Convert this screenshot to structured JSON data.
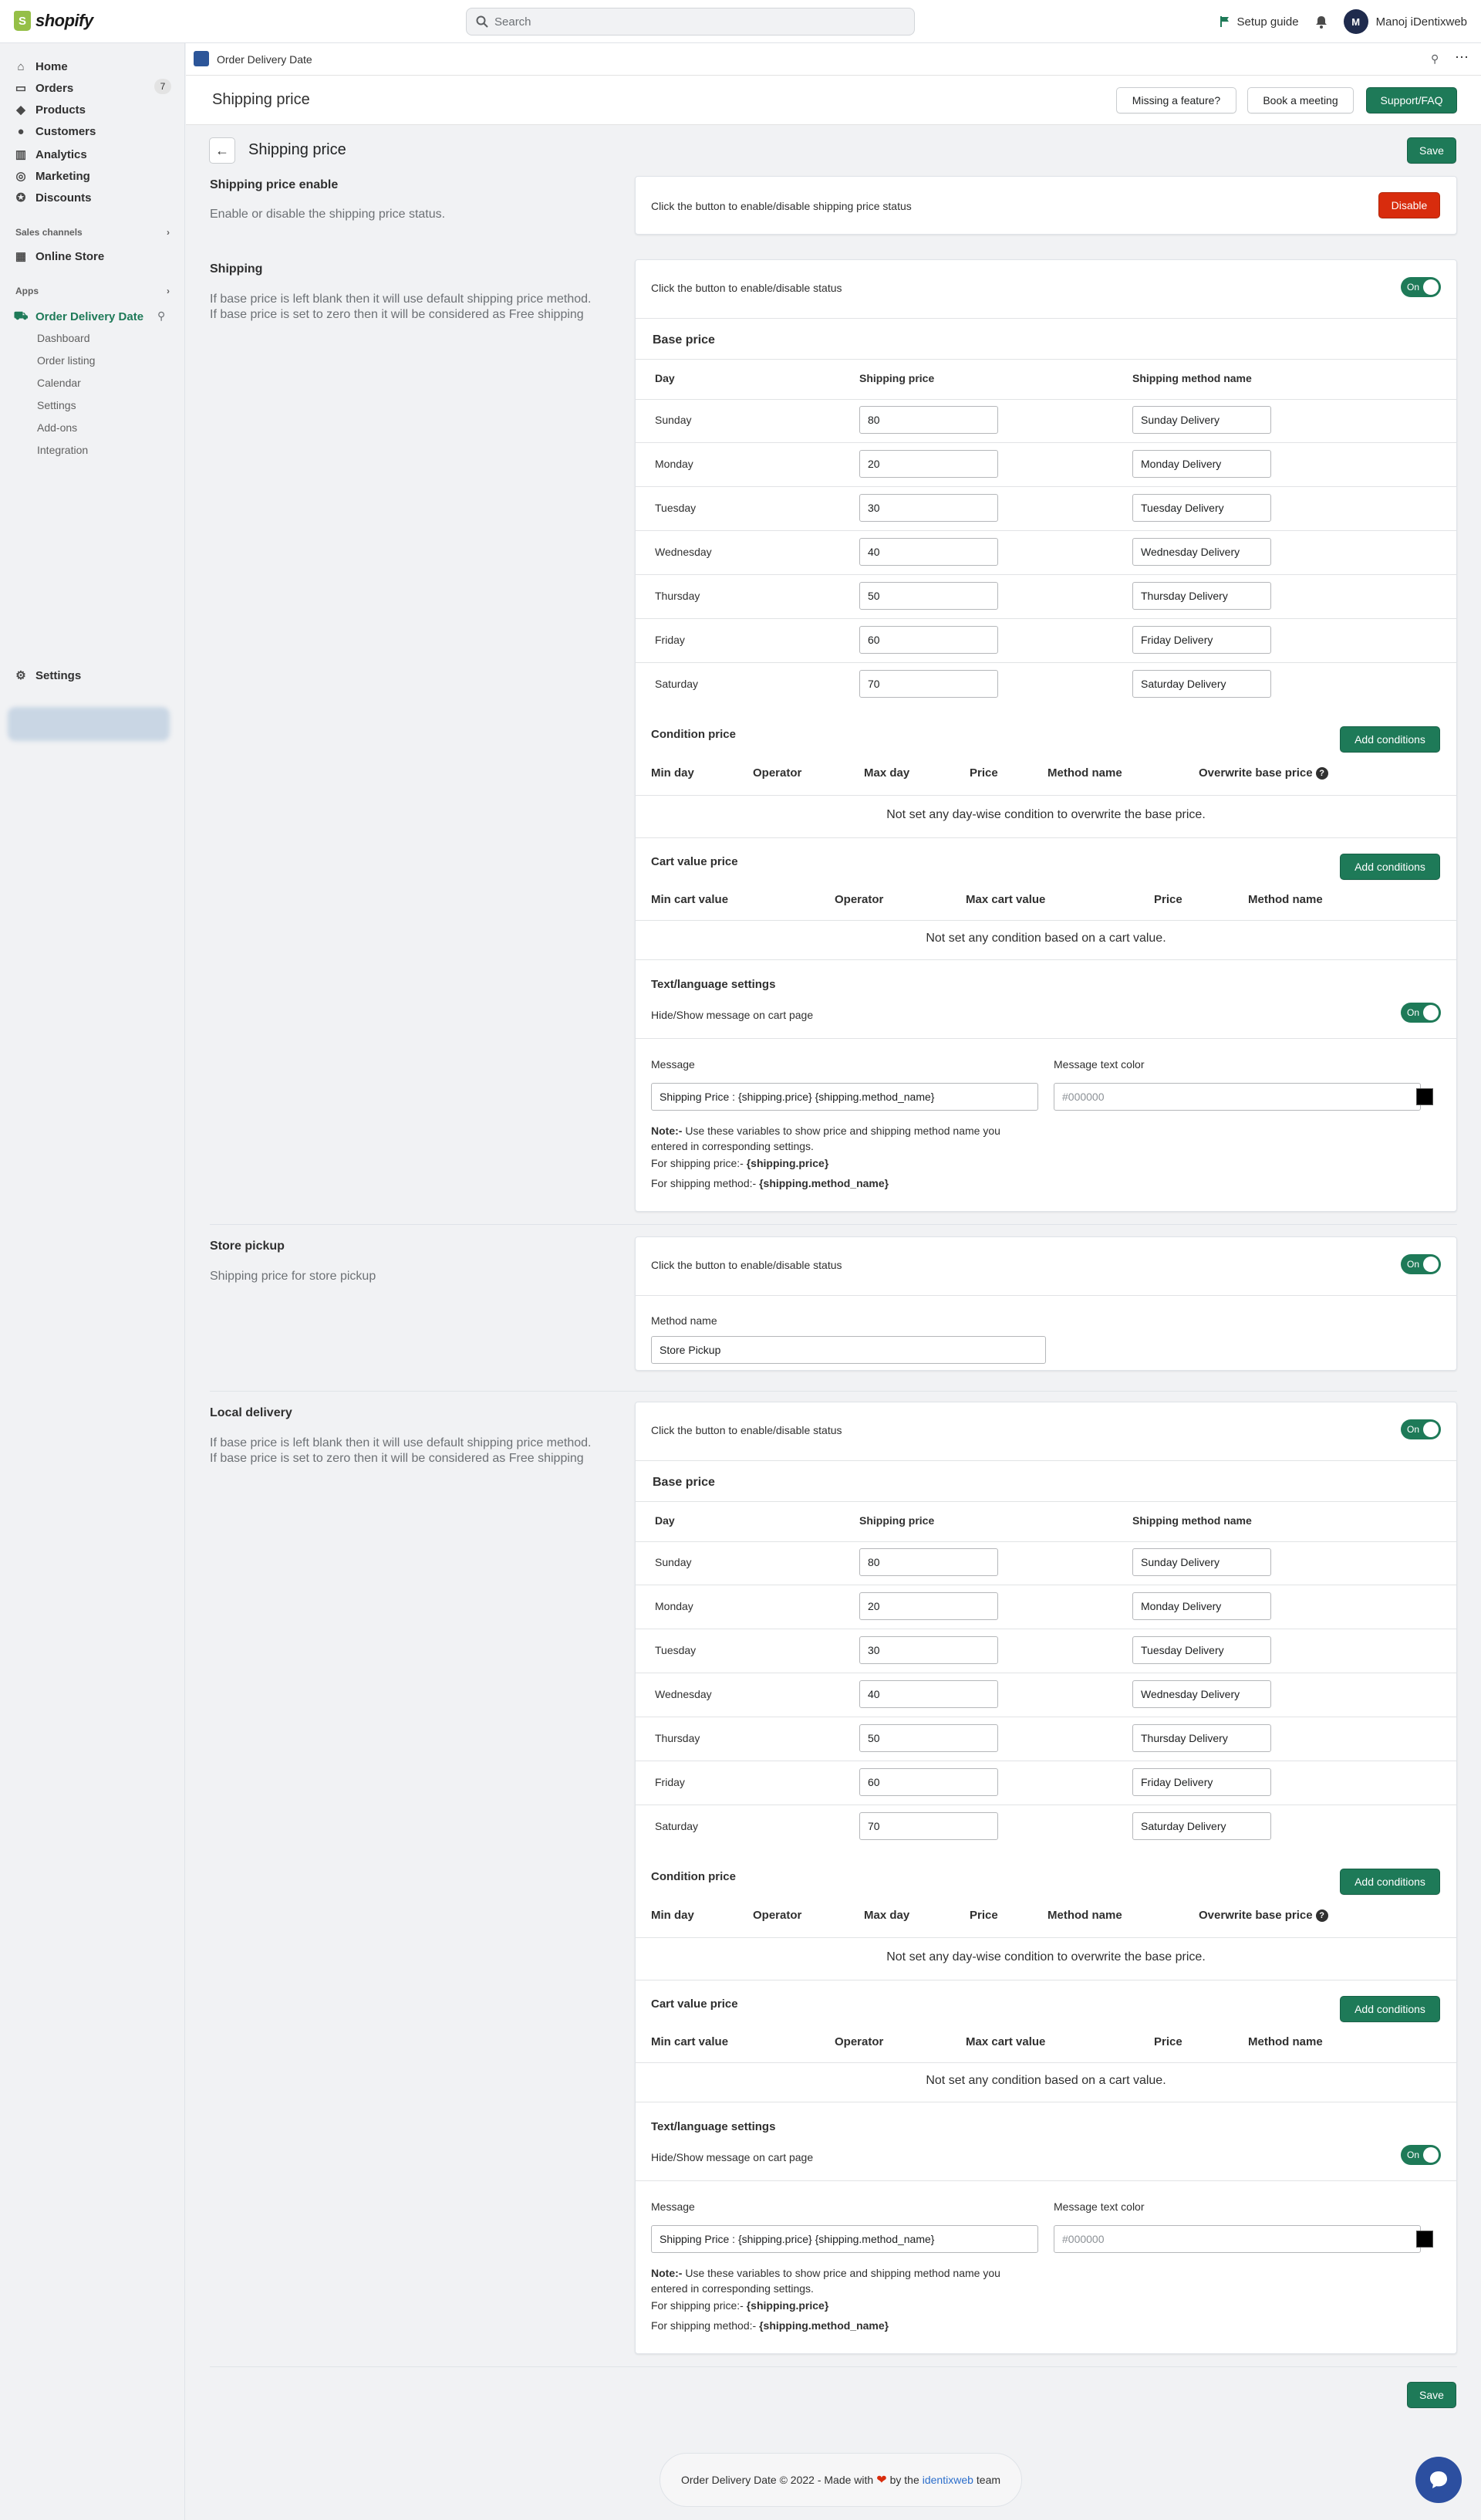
{
  "topbar": {
    "logo": "shopify",
    "search_placeholder": "Search",
    "setup_guide": "Setup guide",
    "avatar_initial": "M",
    "user_name": "Manoj iDentixweb"
  },
  "sidebar": {
    "items": [
      {
        "label": "Home"
      },
      {
        "label": "Orders",
        "badge": "7"
      },
      {
        "label": "Products"
      },
      {
        "label": "Customers"
      },
      {
        "label": "Analytics"
      },
      {
        "label": "Marketing"
      },
      {
        "label": "Discounts"
      }
    ],
    "sales_channels": "Sales channels",
    "online_store": "Online Store",
    "apps": "Apps",
    "app_name": "Order Delivery Date",
    "app_sub": [
      "Dashboard",
      "Order listing",
      "Calendar",
      "Settings",
      "Add-ons",
      "Integration"
    ],
    "settings": "Settings"
  },
  "appbar": {
    "title": "Order Delivery Date"
  },
  "header": {
    "title": "Shipping price",
    "missing": "Missing a feature?",
    "meeting": "Book a meeting",
    "support": "Support/FAQ"
  },
  "page": {
    "title": "Shipping price",
    "save": "Save"
  },
  "enable": {
    "heading": "Shipping price enable",
    "desc": "Enable or disable the shipping price status.",
    "text": "Click the button to enable/disable shipping price status",
    "button": "Disable"
  },
  "status_text": "Click the button to enable/disable status",
  "toggle_on": "On",
  "shipping": {
    "heading": "Shipping",
    "desc1": "If base price is left blank then it will use default shipping price method.",
    "desc2": "If base price is set to zero then it will be considered as Free shipping"
  },
  "base": {
    "title": "Base price",
    "col_day": "Day",
    "col_price": "Shipping price",
    "col_method": "Shipping method name",
    "rows": [
      {
        "day": "Sunday",
        "price": "80",
        "method": "Sunday Delivery"
      },
      {
        "day": "Monday",
        "price": "20",
        "method": "Monday Delivery"
      },
      {
        "day": "Tuesday",
        "price": "30",
        "method": "Tuesday Delivery"
      },
      {
        "day": "Wednesday",
        "price": "40",
        "method": "Wednesday Delivery"
      },
      {
        "day": "Thursday",
        "price": "50",
        "method": "Thursday Delivery"
      },
      {
        "day": "Friday",
        "price": "60",
        "method": "Friday Delivery"
      },
      {
        "day": "Saturday",
        "price": "70",
        "method": "Saturday Delivery"
      }
    ]
  },
  "cond": {
    "title": "Condition price",
    "add": "Add conditions",
    "cols": [
      "Min day",
      "Operator",
      "Max day",
      "Price",
      "Method name",
      "Overwrite base price"
    ],
    "empty": "Not set any day-wise condition to overwrite the base price.",
    "q": "?"
  },
  "cart": {
    "title": "Cart value price",
    "add": "Add conditions",
    "cols": [
      "Min cart value",
      "Operator",
      "Max cart value",
      "Price",
      "Method name"
    ],
    "empty": "Not set any condition based on a cart value."
  },
  "text": {
    "title": "Text/language settings",
    "hide_show": "Hide/Show message on cart page",
    "message_label": "Message",
    "message_value": "Shipping Price : {shipping.price} {shipping.method_name}",
    "color_label": "Message text color",
    "color_placeholder": "#000000",
    "note_prefix": "Note:-",
    "note_text": " Use these variables to show price and shipping method name you",
    "note_text2": "entered in corresponding settings.",
    "price_prefix": "For shipping price:- ",
    "price_var": "{shipping.price}",
    "method_prefix": "For shipping method:- ",
    "method_var": "{shipping.method_name}"
  },
  "pickup": {
    "heading": "Store pickup",
    "desc": "Shipping price for store pickup",
    "method_label": "Method name",
    "method_value": "Store Pickup"
  },
  "local": {
    "heading": "Local delivery"
  },
  "footer": {
    "text1": "Order Delivery Date © 2022 - Made with",
    "text2": "by the",
    "link": "identixweb",
    "text3": "team"
  },
  "colors": {
    "accent": "#1e7a58",
    "danger": "#d82c0d",
    "link": "#2c6ecb"
  }
}
